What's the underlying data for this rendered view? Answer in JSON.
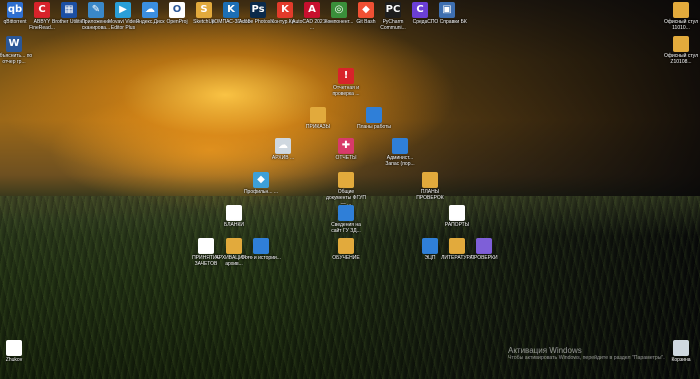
{
  "desktop_icons": [
    {
      "label": "qBittorrent",
      "glyph": "qb",
      "color": "#2f6fd0"
    },
    {
      "label": "ABBYY FineRead...",
      "glyph": "C",
      "color": "#d8232a"
    },
    {
      "label": "Brother Utilities",
      "glyph": "▦",
      "color": "#1c4fa3"
    },
    {
      "label": "Приложение сканирова...",
      "glyph": "✎",
      "color": "#3a88c8"
    },
    {
      "label": "Movavi Video Editor Plus",
      "glyph": "▶",
      "color": "#2a9fd8"
    },
    {
      "label": "Яндекс.Диск",
      "glyph": "☁",
      "color": "#3b8fe0"
    },
    {
      "label": "OpenProj",
      "glyph": "O",
      "color": "#ffffff"
    },
    {
      "label": "SketchUp",
      "glyph": "S",
      "color": "#e2aa3c"
    },
    {
      "label": "КОМПАС-3D v19",
      "glyph": "K",
      "color": "#1d6fb5"
    },
    {
      "label": "Adobe Photosh...",
      "glyph": "Ps",
      "color": "#0b2a4a"
    },
    {
      "label": "Контур.Кр...",
      "glyph": "K",
      "color": "#e23b2a"
    },
    {
      "label": "AutoCAD 2021 — ...",
      "glyph": "A",
      "color": "#c8102e"
    },
    {
      "label": "Компонент...",
      "glyph": "◎",
      "color": "#3a8f3a"
    },
    {
      "label": "Git Bash",
      "glyph": "◆",
      "color": "#f05033"
    },
    {
      "label": "PyCharm Communi...",
      "glyph": "PC",
      "color": "#1e1e1e"
    },
    {
      "label": "Среда",
      "glyph": "C",
      "color": "#6b3fd6"
    },
    {
      "label": "СПО Справки БК",
      "glyph": "▣",
      "color": "#3e6fb0"
    },
    {
      "label": "Офисный стул 11010...",
      "glyph": "",
      "color": "#e2aa3c"
    },
    {
      "label": "Объяснить... по отчер гр...",
      "glyph": "W",
      "color": "#2b5797"
    },
    {
      "label": "Офисный стул Z10108...",
      "glyph": "",
      "color": "#e2aa3c"
    },
    {
      "label": "Отчетная и проверка ...",
      "glyph": "!",
      "color": "#d8232a"
    },
    {
      "label": "ПРИКАЗЫ",
      "glyph": "",
      "color": "#e2aa3c"
    },
    {
      "label": "Планы работы",
      "glyph": "",
      "color": "#2f7fd8"
    },
    {
      "label": "АРХИВ ...",
      "glyph": "☁",
      "color": "#cfd8e0"
    },
    {
      "label": "ОТЧЕТЫ",
      "glyph": "✚",
      "color": "#d83a6a"
    },
    {
      "label": "Админист... Запас (пор...",
      "glyph": "",
      "color": "#2f7fd8"
    },
    {
      "label": "Профильн... ...",
      "glyph": "◆",
      "color": "#3ea0d8"
    },
    {
      "label": "Общие документы ФГУП — ...",
      "glyph": "",
      "color": "#e2aa3c"
    },
    {
      "label": "ПЛАНЫ ПРОВЕРОК",
      "glyph": "",
      "color": "#e2aa3c"
    },
    {
      "label": "БЛАНКИ",
      "glyph": "",
      "color": "#ffffff"
    },
    {
      "label": "Сведения на сайт ГУ ЗД...",
      "glyph": "",
      "color": "#2f7fd8"
    },
    {
      "label": "РАПОРТЫ",
      "glyph": "",
      "color": "#ffffff"
    },
    {
      "label": "ПРИНЯТИЕ ЗАЧЕТОВ",
      "glyph": "",
      "color": "#ffffff"
    },
    {
      "label": "АРХИВАЦИЯ — архив...",
      "glyph": "",
      "color": "#e2aa3c"
    },
    {
      "label": "Фото и истории...",
      "glyph": "",
      "color": "#2f7fd8"
    },
    {
      "label": "ОБУЧЕНИЕ",
      "glyph": "",
      "color": "#e2aa3c"
    },
    {
      "label": "ЭЦП",
      "glyph": "",
      "color": "#2f7fd8"
    },
    {
      "label": "ЛИТЕРАТУРА",
      "glyph": "",
      "color": "#e2aa3c"
    },
    {
      "label": "ПРОВЕРКИ",
      "glyph": "",
      "color": "#7e5fd8"
    },
    {
      "label": "Zhukov",
      "glyph": "",
      "color": "#ffffff"
    },
    {
      "label": "Корзина",
      "glyph": "",
      "color": "#cfd8e0"
    }
  ],
  "watermark": {
    "title": "Активация Windows",
    "subtitle": "Чтобы активировать Windows, перейдите в раздел \"Параметры\"."
  }
}
